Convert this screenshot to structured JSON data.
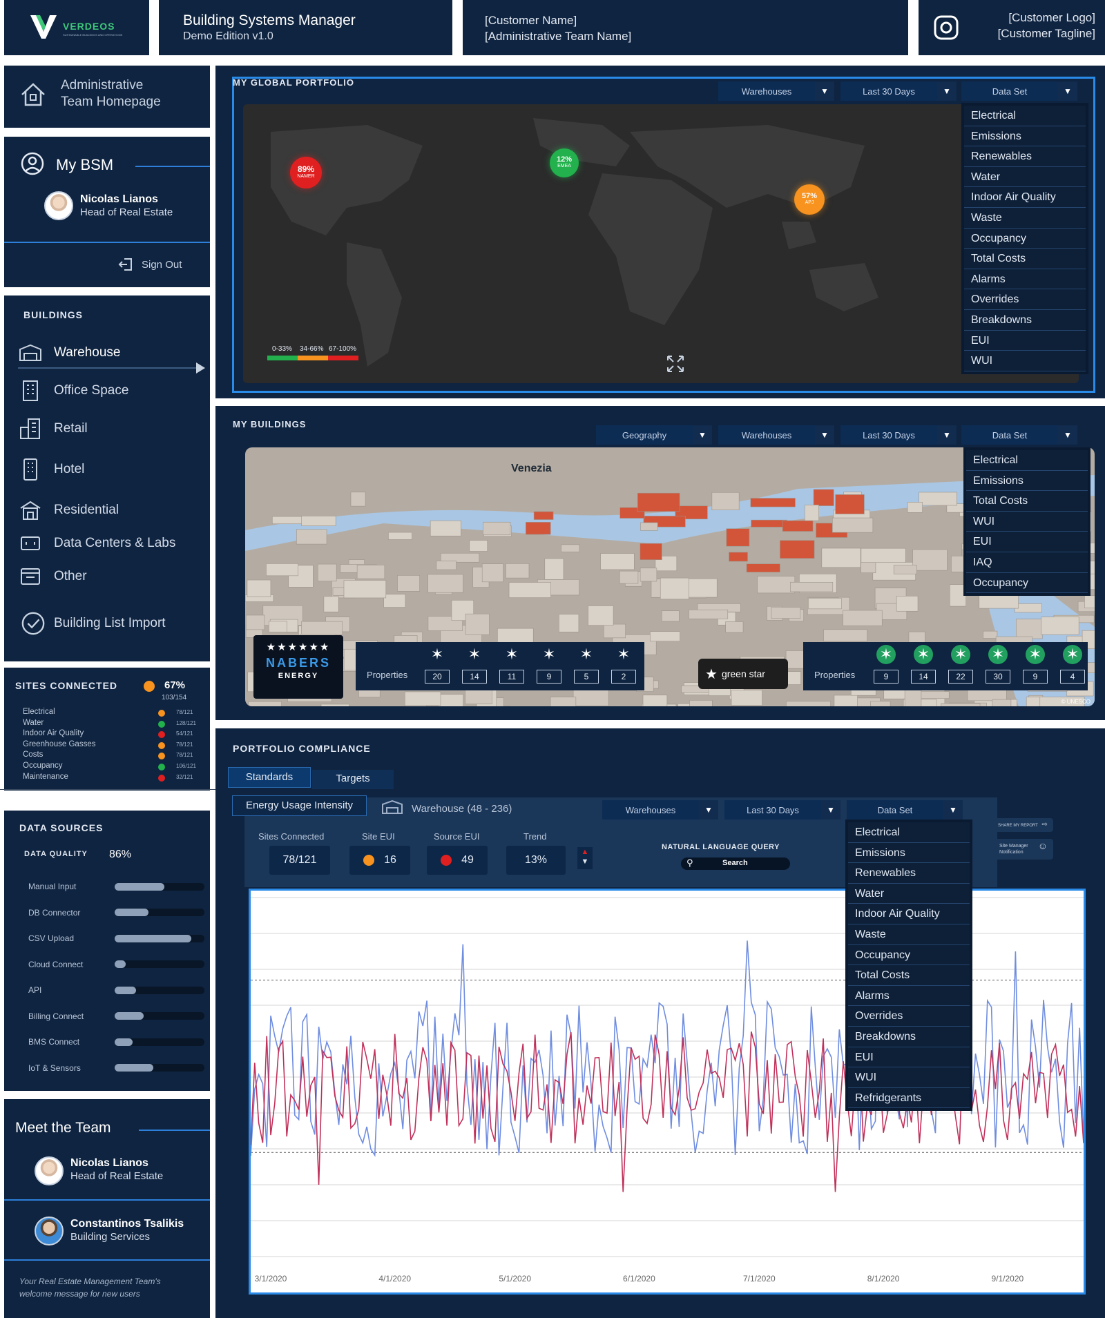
{
  "header": {
    "brand": "VERDEOS",
    "brand_tagline": "SUSTAINABLE BUILDINGS AND OPERATIONS",
    "app_title": "Building Systems Manager",
    "app_edition": "Demo Edition v1.0",
    "customer_name": "[Customer Name]",
    "team_name": "[Administrative Team Name]",
    "customer_logo": "[Customer Logo]",
    "customer_tagline": "[Customer Tagline]"
  },
  "sidebar": {
    "homepage_line1": "Administrative",
    "homepage_line2": "Team Homepage",
    "my_bsm": "My BSM",
    "user_name": "Nicolas Lianos",
    "user_role": "Head of Real Estate",
    "sign_out": "Sign Out",
    "buildings_heading": "BUILDINGS",
    "building_types": [
      "Warehouse",
      "Office Space",
      "Retail",
      "Hotel",
      "Residential",
      "Data Centers & Labs",
      "Other"
    ],
    "building_list_import": "Building List Import"
  },
  "sites_connected": {
    "heading": "SITES CONNECTED",
    "percent": "67%",
    "fraction": "103/154",
    "status_color": "#f7931e",
    "rows": [
      {
        "name": "Electrical",
        "frac": "78/121",
        "color": "#f7931e"
      },
      {
        "name": "Water",
        "frac": "128/121",
        "color": "#22b14c"
      },
      {
        "name": "Indoor Air Quality",
        "frac": "54/121",
        "color": "#e02020"
      },
      {
        "name": "Greenhouse Gasses",
        "frac": "78/121",
        "color": "#f7931e"
      },
      {
        "name": "Costs",
        "frac": "78/121",
        "color": "#f7931e"
      },
      {
        "name": "Occupancy",
        "frac": "106/121",
        "color": "#22b14c"
      },
      {
        "name": "Maintenance",
        "frac": "32/121",
        "color": "#e02020"
      }
    ]
  },
  "data_sources": {
    "heading": "DATA SOURCES",
    "quality_label": "DATA QUALITY",
    "quality_value": "86%",
    "sources": [
      {
        "name": "Manual Input",
        "level": 0.55
      },
      {
        "name": "DB Connector",
        "level": 0.38
      },
      {
        "name": "CSV Upload",
        "level": 0.85
      },
      {
        "name": "Cloud Connect",
        "level": 0.12
      },
      {
        "name": "API",
        "level": 0.24
      },
      {
        "name": "Billing Connect",
        "level": 0.32
      },
      {
        "name": "BMS Connect",
        "level": 0.2
      },
      {
        "name": "IoT & Sensors",
        "level": 0.43
      }
    ]
  },
  "team": {
    "heading": "Meet the Team",
    "members": [
      {
        "name": "Nicolas Lianos",
        "role": "Head of Real Estate"
      },
      {
        "name": "Constantinos Tsalikis",
        "role": "Building Services"
      }
    ],
    "welcome_line1": "Your Real Estate Management Team's",
    "welcome_line2": "welcome message for new users"
  },
  "portfolio": {
    "heading": "MY GLOBAL PORTFOLIO",
    "filters": [
      "Warehouses",
      "Last 30 Days",
      "Data Set"
    ],
    "markers": [
      {
        "value": "89%",
        "region": "NAMER",
        "color": "#e02020"
      },
      {
        "value": "12%",
        "region": "EMEA",
        "color": "#22b14c"
      },
      {
        "value": "57%",
        "region": "APJ",
        "color": "#f7931e"
      }
    ],
    "legend": [
      "0-33%",
      "34-66%",
      "67-100%"
    ],
    "legend_colors": [
      "#22b14c",
      "#f7931e",
      "#e02020"
    ],
    "dataset_menu": [
      "Electrical",
      "Emissions",
      "Renewables",
      "Water",
      "Indoor Air Quality",
      "Waste",
      "Occupancy",
      "Total Costs",
      "Alarms",
      "Overrides",
      "Breakdowns",
      "EUI",
      "WUI"
    ]
  },
  "buildings": {
    "heading": "MY BUILDINGS",
    "filters": [
      "Geography",
      "Warehouses",
      "Last 30 Days",
      "Data Set"
    ],
    "map_city": "Venezia",
    "dataset_menu": [
      "Electrical",
      "Emissions",
      "Total Costs",
      "WUI",
      "EUI",
      "IAQ",
      "Occupancy"
    ],
    "nabers": {
      "line1": "NABERS",
      "line2": "ENERGY",
      "properties_label": "Properties",
      "counts": [
        "20",
        "14",
        "11",
        "9",
        "5",
        "2"
      ]
    },
    "greenstar": {
      "label": "green star",
      "properties_label": "Properties",
      "counts": [
        "9",
        "14",
        "22",
        "30",
        "9",
        "4"
      ]
    },
    "map_credit": "© UNESCO"
  },
  "compliance": {
    "heading": "PORTFOLIO COMPLIANCE",
    "tabs": [
      "Standards",
      "Targets"
    ],
    "metric_select": "Energy Usage Intensity",
    "building_filter": "Warehouse (48 - 236)",
    "filters": [
      "Warehouses",
      "Last 30 Days",
      "Data Set"
    ],
    "stats": {
      "sites_connected_label": "Sites Connected",
      "sites_connected": "78/121",
      "site_eui_label": "Site EUI",
      "site_eui": "16",
      "site_eui_color": "#f7931e",
      "source_eui_label": "Source EUI",
      "source_eui": "49",
      "source_eui_color": "#e02020",
      "trend_label": "Trend",
      "trend": "13%"
    },
    "nlq_label": "NATURAL LANGUAGE QUERY",
    "search_label": "Search",
    "share_label": "SHARE MY REPORT",
    "notify_line1": "Site Manager",
    "notify_line2": "Notification",
    "dataset_menu": [
      "Electrical",
      "Emissions",
      "Renewables",
      "Water",
      "Indoor Air Quality",
      "Waste",
      "Occupancy",
      "Total Costs",
      "Alarms",
      "Overrides",
      "Breakdowns",
      "EUI",
      "WUI",
      "Refridgerants"
    ]
  },
  "chart_data": {
    "type": "line",
    "title": "",
    "xlabel": "",
    "ylabel": "",
    "x_tick_labels": [
      "3/1/2020",
      "4/1/2020",
      "5/1/2020",
      "6/1/2020",
      "7/1/2020",
      "8/1/2020",
      "9/1/2020"
    ],
    "x_range": [
      "2020-02-25",
      "2020-09-20"
    ],
    "ylim": [
      0,
      100
    ],
    "reference_lines": [
      77,
      29
    ],
    "grid": true,
    "series": [
      {
        "color": "#6f8de0",
        "sample_every_days": 1,
        "baseline": 50,
        "spread": 22,
        "peak_values": [
          88,
          85,
          87,
          84,
          82
        ]
      },
      {
        "color": "#c0305a",
        "sample_every_days": 1,
        "baseline": 47,
        "spread": 16,
        "trough_values": [
          18,
          22,
          20
        ]
      }
    ]
  }
}
